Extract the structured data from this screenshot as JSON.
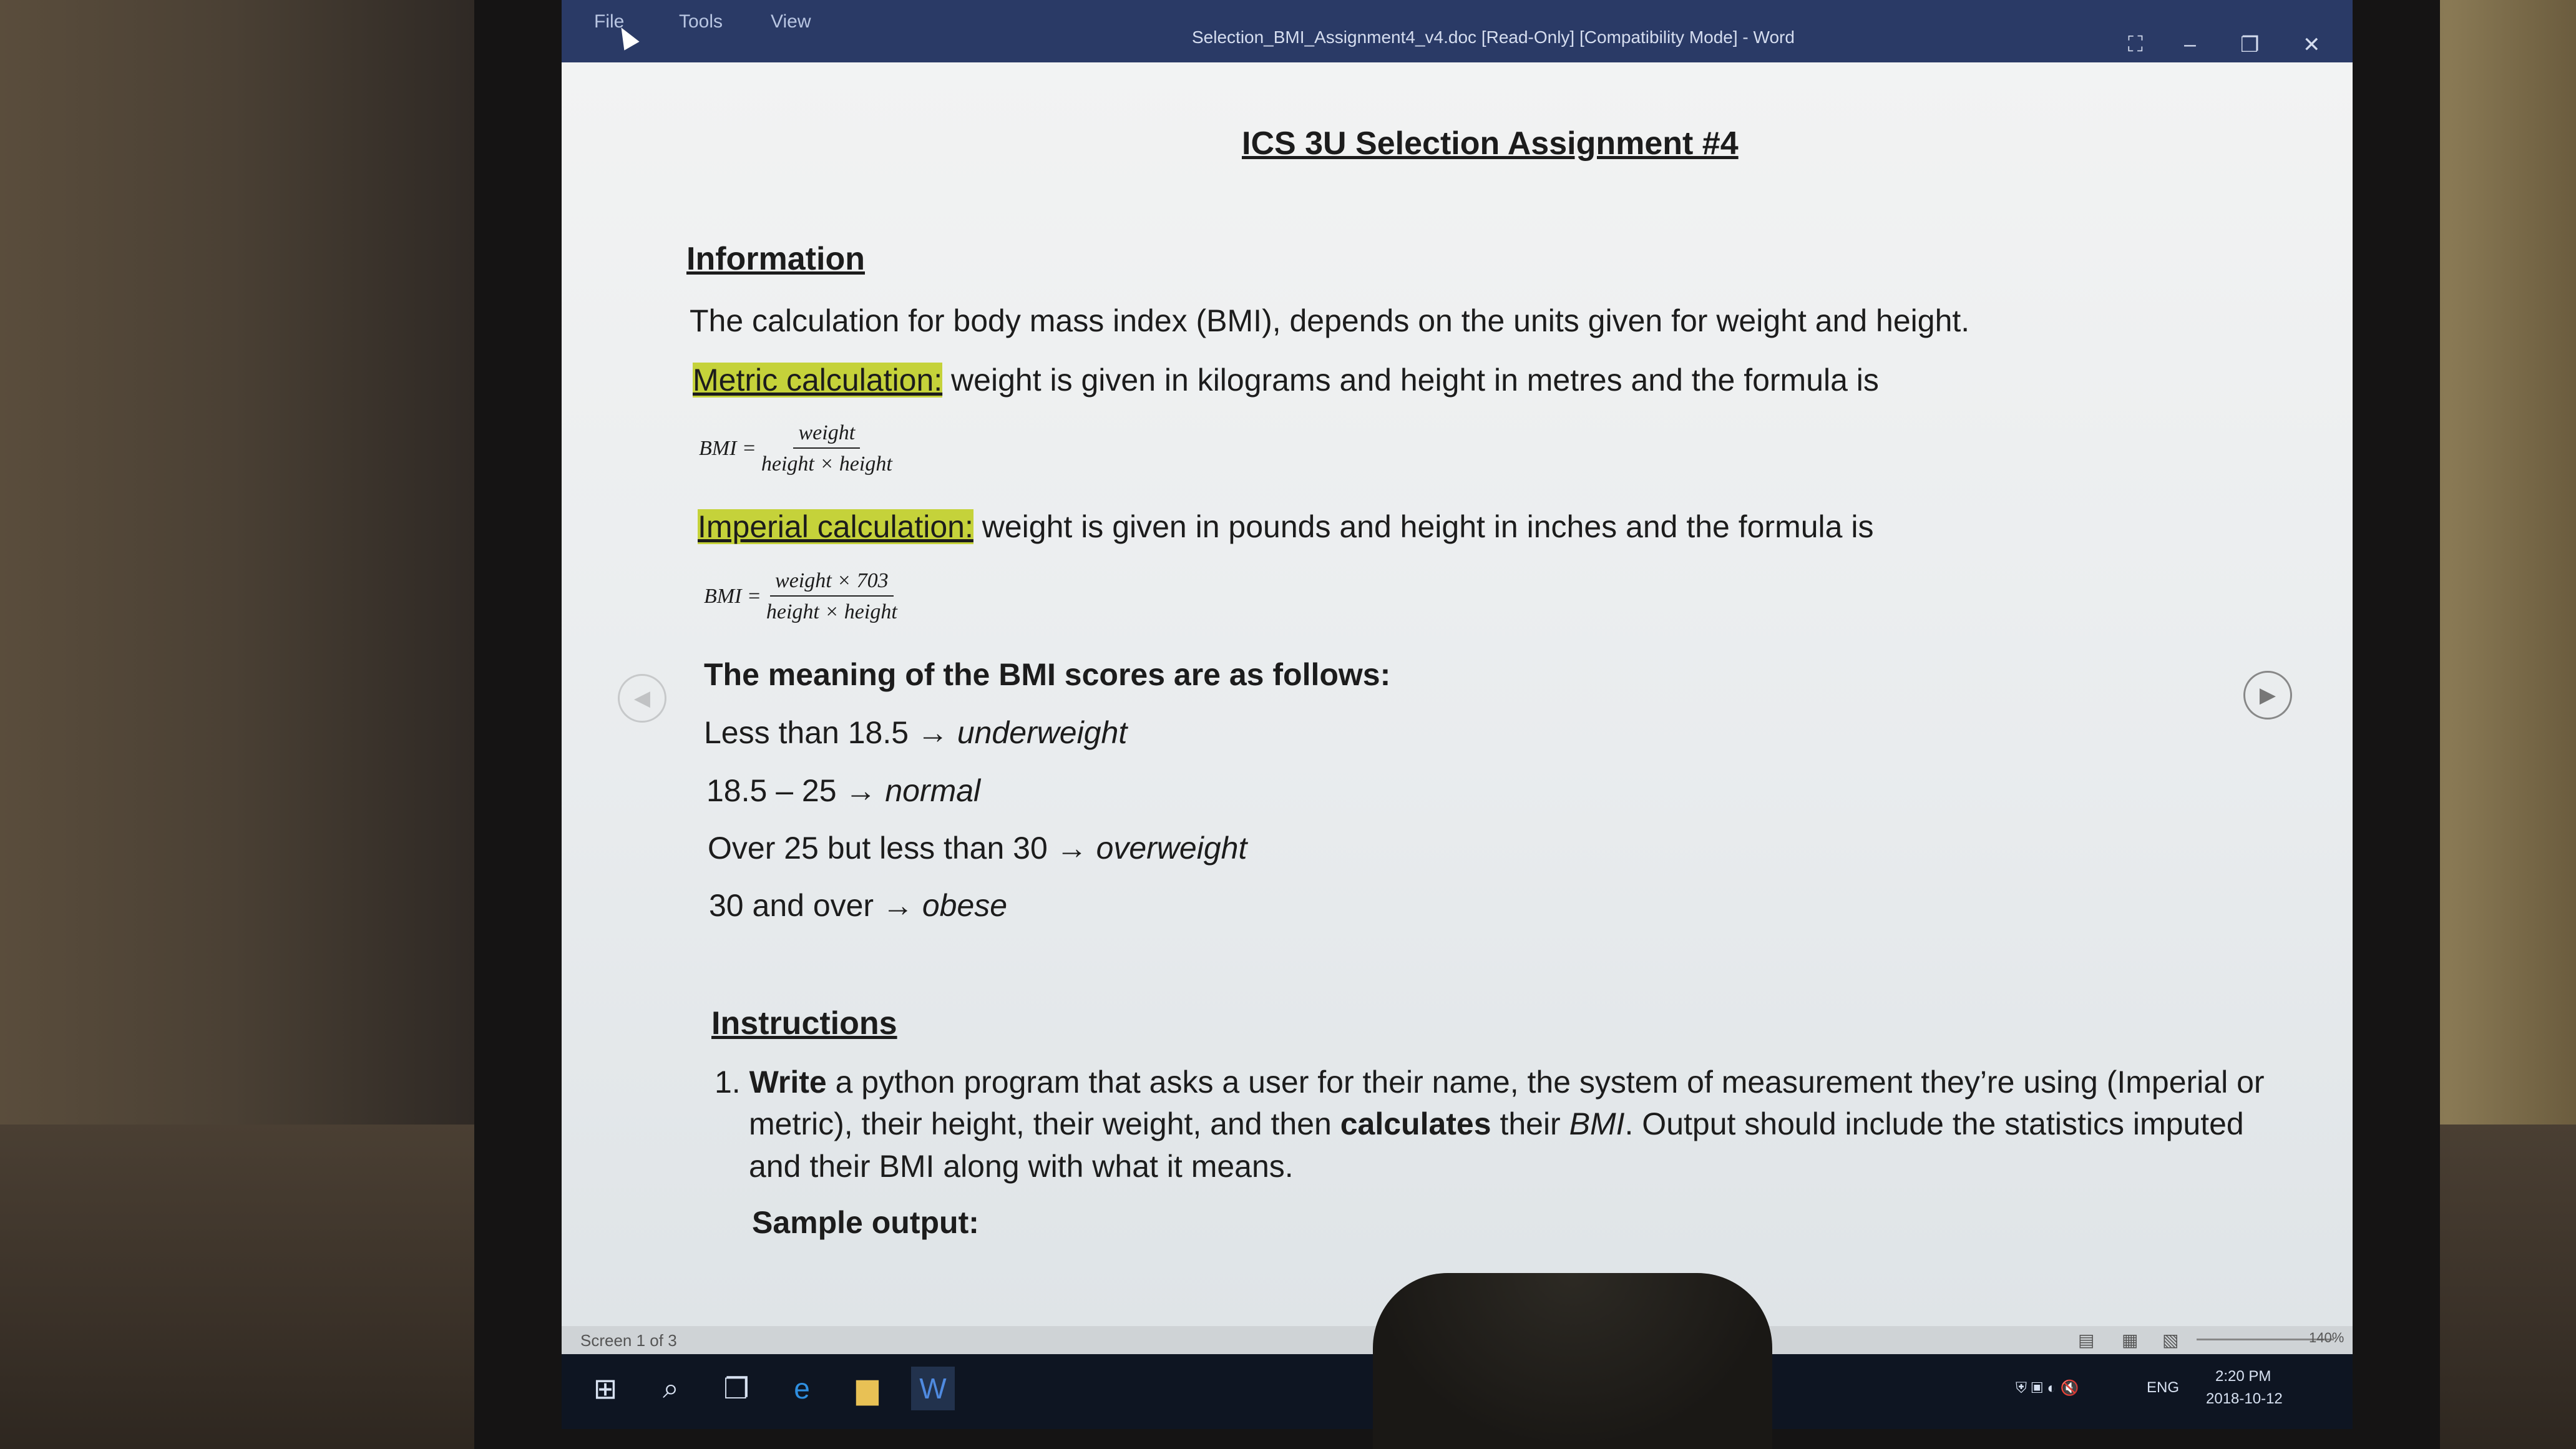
{
  "window": {
    "menu": [
      "File",
      "Tools",
      "View"
    ],
    "title": "Selection_BMI_Assignment4_v4.doc [Read-Only] [Compatibility Mode] - Word",
    "controls": {
      "fullscreen": "⛶",
      "minimize": "–",
      "restore": "❐",
      "close": "✕"
    }
  },
  "document": {
    "title": "ICS 3U Selection Assignment #4",
    "information_heading": "Information",
    "intro": "The calculation for body mass index (BMI), depends on the units given for weight and height.",
    "metric_label": "Metric calculation:",
    "metric_text": " weight is given in kilograms and height in metres and the formula is",
    "metric_formula": {
      "lhs": "BMI =",
      "numerator": "weight",
      "denominator": "height × height"
    },
    "imperial_label": "Imperial calculation:",
    "imperial_text": " weight is given in pounds and height in inches and the formula is",
    "imperial_formula": {
      "lhs": "BMI =",
      "numerator": "weight × 703",
      "denominator": "height × height"
    },
    "meaning_heading": "The meaning of the BMI scores are as follows:",
    "ranges": [
      {
        "range": "Less than 18.5 → ",
        "category": "underweight"
      },
      {
        "range": "18.5 – 25 → ",
        "category": "normal"
      },
      {
        "range": "Over 25 but less than 30 → ",
        "category": "overweight"
      },
      {
        "range": "30 and over → ",
        "category": "obese"
      }
    ],
    "instructions_heading": "Instructions",
    "instruction_1": {
      "number": "1.",
      "write": "Write",
      "line1": " a python program that asks a user for their name, the system of measurement they’re using (Imperial or",
      "line2a": "metric), their height, their weight, and then ",
      "calculates": "calculates",
      "line2b": " their ",
      "bmi": "BMI",
      "line2c": ".  Output should include the statistics imputed",
      "line3": "and their BMI along with what it means."
    },
    "sample_output": "Sample output:"
  },
  "status": {
    "screen": "Screen 1 of 3",
    "zoom": "140%"
  },
  "taskbar": {
    "lang": "ENG",
    "time": "2:20 PM",
    "date": "2018-10-12"
  }
}
